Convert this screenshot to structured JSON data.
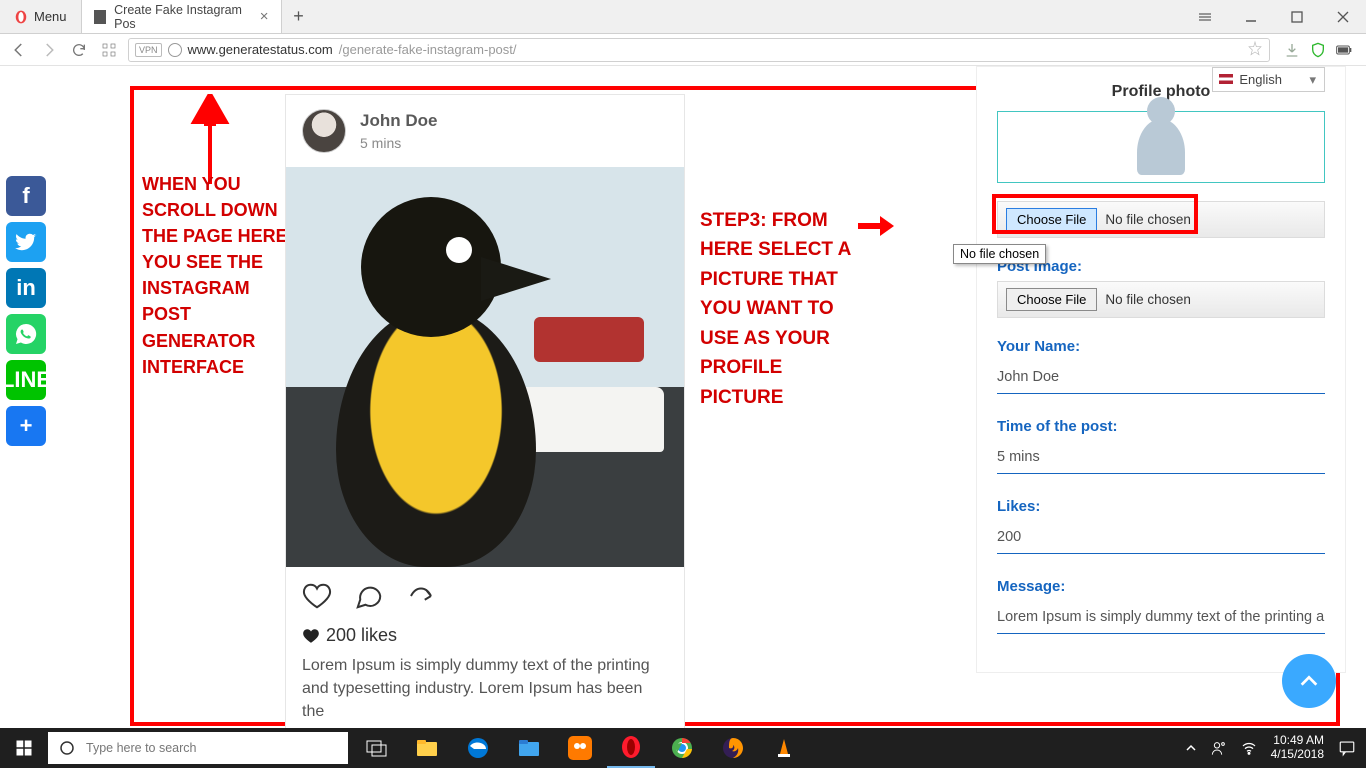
{
  "browser": {
    "menu": "Menu",
    "tab_title": "Create Fake Instagram Pos",
    "url_domain": "www.generatestatus.com",
    "url_path": "/generate-fake-instagram-post/"
  },
  "share": {
    "facebook": "f",
    "twitter": "t",
    "linkedin": "in",
    "whatsapp": "✆",
    "line": "LINE",
    "more": "+"
  },
  "annotations": {
    "left": "WHEN YOU SCROLL DOWN THE PAGE HERE YOU SEE THE INSTAGRAM POST GENERATOR INTERFACE",
    "right": "STEP3: FROM HERE SELECT A PICTURE THAT YOU WANT TO USE AS YOUR PROFILE PICTURE"
  },
  "ig": {
    "username": "John Doe",
    "time": "5 mins",
    "likes_count": "200 likes",
    "message": "Lorem Ipsum is simply dummy text of the printing and typesetting industry. Lorem Ipsum has been the"
  },
  "form": {
    "language": "English",
    "profile_photo_label": "Profile photo",
    "choose_file": "Choose File",
    "no_file": "No file chosen",
    "tooltip": "No file chosen",
    "post_image_label": "Post Image:",
    "your_name_label": "Your Name:",
    "your_name_value": "John Doe",
    "time_label": "Time of the post:",
    "time_value": "5 mins",
    "likes_label": "Likes:",
    "likes_value": "200",
    "message_label": "Message:",
    "message_value": "Lorem Ipsum is simply dummy text of the printing and"
  },
  "taskbar": {
    "search_placeholder": "Type here to search",
    "time": "10:49 AM",
    "date": "4/15/2018"
  }
}
